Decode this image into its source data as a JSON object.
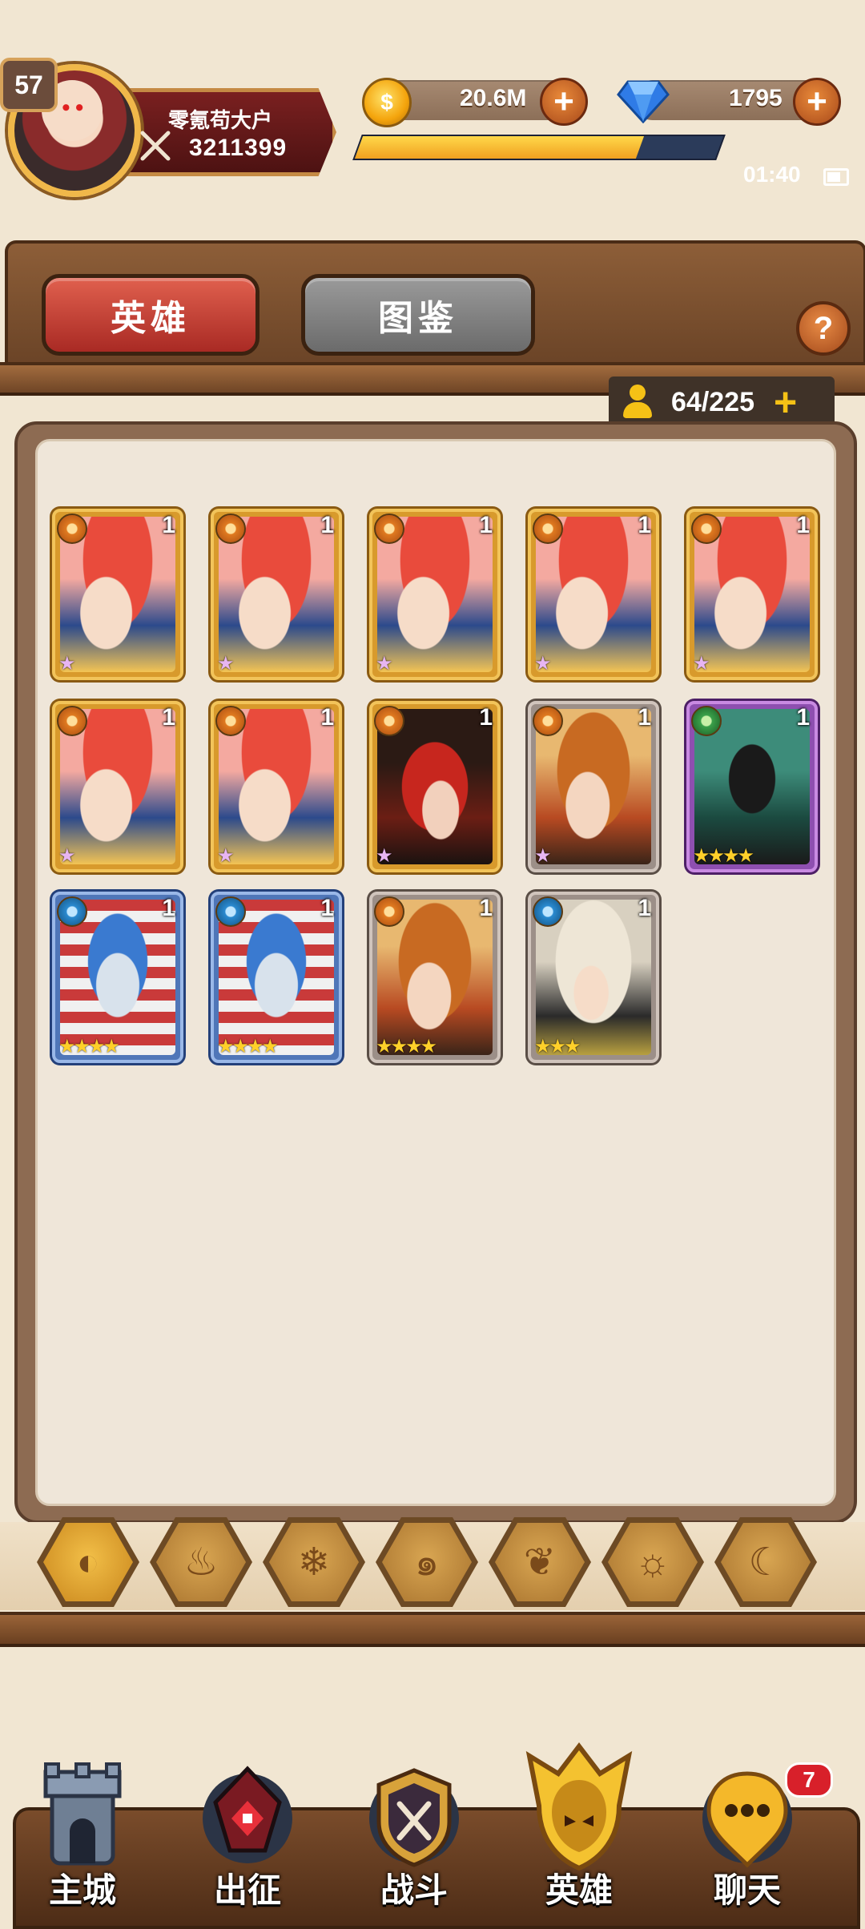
{
  "player": {
    "level": "57",
    "name": "零氪苟大户",
    "power": "3211399"
  },
  "resources": {
    "gold": "20.6M",
    "gems": "1795",
    "xp_fraction": 0.78
  },
  "status": {
    "time": "01:40"
  },
  "tabs": {
    "heroes": "英雄",
    "codex": "图鉴"
  },
  "help": "?",
  "capacity": {
    "text": "64/225",
    "plus": "+"
  },
  "heroes": [
    {
      "rarity": "gold",
      "element": "fire",
      "level": "1",
      "stars": "★",
      "star_color": "pink",
      "art": "redhair"
    },
    {
      "rarity": "gold",
      "element": "fire",
      "level": "1",
      "stars": "★",
      "star_color": "pink",
      "art": "redhair"
    },
    {
      "rarity": "gold",
      "element": "fire",
      "level": "1",
      "stars": "★",
      "star_color": "pink",
      "art": "redhair"
    },
    {
      "rarity": "gold",
      "element": "fire",
      "level": "1",
      "stars": "★",
      "star_color": "pink",
      "art": "redhair"
    },
    {
      "rarity": "gold",
      "element": "fire",
      "level": "1",
      "stars": "★",
      "star_color": "pink",
      "art": "redhair"
    },
    {
      "rarity": "gold",
      "element": "fire",
      "level": "1",
      "stars": "★",
      "star_color": "pink",
      "art": "redhair"
    },
    {
      "rarity": "gold",
      "element": "fire",
      "level": "1",
      "stars": "★",
      "star_color": "pink",
      "art": "redhair"
    },
    {
      "rarity": "gold",
      "element": "fire",
      "level": "1",
      "stars": "★",
      "star_color": "pink",
      "art": "witch"
    },
    {
      "rarity": "grey",
      "element": "fire",
      "level": "1",
      "stars": "★",
      "star_color": "pink",
      "art": "goggle"
    },
    {
      "rarity": "purple",
      "element": "earth",
      "level": "1",
      "stars": "★★★★",
      "star_color": "gold",
      "art": "jackal"
    },
    {
      "rarity": "blue",
      "element": "water",
      "level": "1",
      "stars": "★★★★",
      "star_color": "gold",
      "art": "robot"
    },
    {
      "rarity": "blue",
      "element": "water",
      "level": "1",
      "stars": "★★★★",
      "star_color": "gold",
      "art": "robot"
    },
    {
      "rarity": "grey",
      "element": "fire",
      "level": "1",
      "stars": "★★★★",
      "star_color": "gold",
      "art": "goggle"
    },
    {
      "rarity": "grey",
      "element": "water",
      "level": "1",
      "stars": "★★★",
      "star_color": "gold",
      "art": "sheep"
    }
  ],
  "filters": [
    {
      "icon": "all-elements-icon",
      "glyph": "◐",
      "active": true
    },
    {
      "icon": "fire-element-icon",
      "glyph": "♨",
      "active": false
    },
    {
      "icon": "ice-element-icon",
      "glyph": "❄",
      "active": false
    },
    {
      "icon": "water-element-icon",
      "glyph": "๑",
      "active": false
    },
    {
      "icon": "earth-element-icon",
      "glyph": "❦",
      "active": false
    },
    {
      "icon": "light-element-icon",
      "glyph": "☼",
      "active": false
    },
    {
      "icon": "dark-element-icon",
      "glyph": "☾",
      "active": false
    }
  ],
  "nav": [
    {
      "label": "主城",
      "icon": "castle-icon"
    },
    {
      "label": "出征",
      "icon": "expedition-icon"
    },
    {
      "label": "战斗",
      "icon": "battle-icon"
    },
    {
      "label": "英雄",
      "icon": "hero-icon"
    },
    {
      "label": "聊天",
      "icon": "chat-icon",
      "badge": "7"
    }
  ]
}
